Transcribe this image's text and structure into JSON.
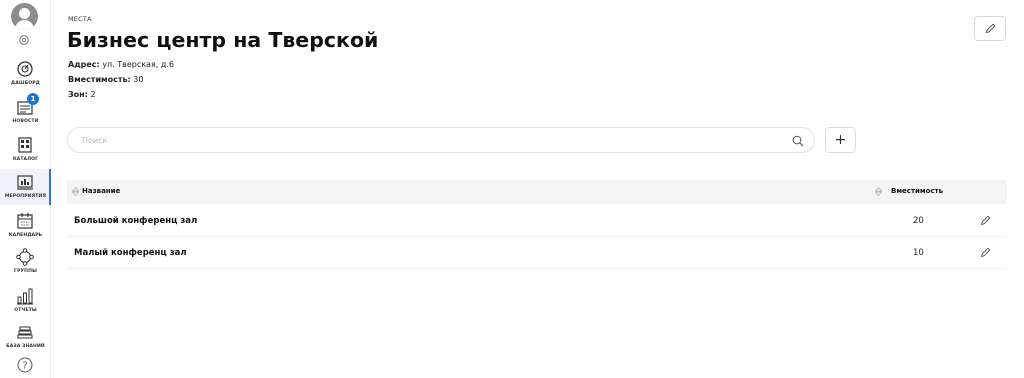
{
  "sidebar": {
    "items": [
      {
        "label": "ДАШБОРД",
        "icon": "dashboard-icon"
      },
      {
        "label": "НОВОСТИ",
        "icon": "news-icon",
        "badge": "1"
      },
      {
        "label": "КАТАЛОГ",
        "icon": "catalog-icon"
      },
      {
        "label": "МЕРОПРИЯТИЯ",
        "icon": "events-icon",
        "active": true
      },
      {
        "label": "КАЛЕНДАРЬ",
        "icon": "calendar-icon"
      },
      {
        "label": "ГРУППЫ",
        "icon": "groups-icon"
      },
      {
        "label": "ОТЧЕТЫ",
        "icon": "reports-icon"
      },
      {
        "label": "БАЗА ЗНАНИЙ",
        "icon": "knowledge-base-icon"
      }
    ],
    "accent": "#2f6fd6",
    "badge_color": "#1e78d0"
  },
  "header": {
    "breadcrumb": "МЕСТА",
    "title": "Бизнес центр на Тверской",
    "address_label": "Адрес:",
    "address_value": " ул. Тверская, д.6",
    "capacity_label": "Вместимость:",
    "capacity_value": " 30",
    "zones_label": "Зон:",
    "zones_value": " 2"
  },
  "search": {
    "placeholder": "Поиск",
    "value": ""
  },
  "add_button": {
    "label": "+"
  },
  "table": {
    "columns": [
      "Название",
      "Вместимость"
    ],
    "rows": [
      {
        "name": "Большой конференц зал",
        "capacity": "20"
      },
      {
        "name": "Малый конференц зал",
        "capacity": "10"
      }
    ]
  }
}
